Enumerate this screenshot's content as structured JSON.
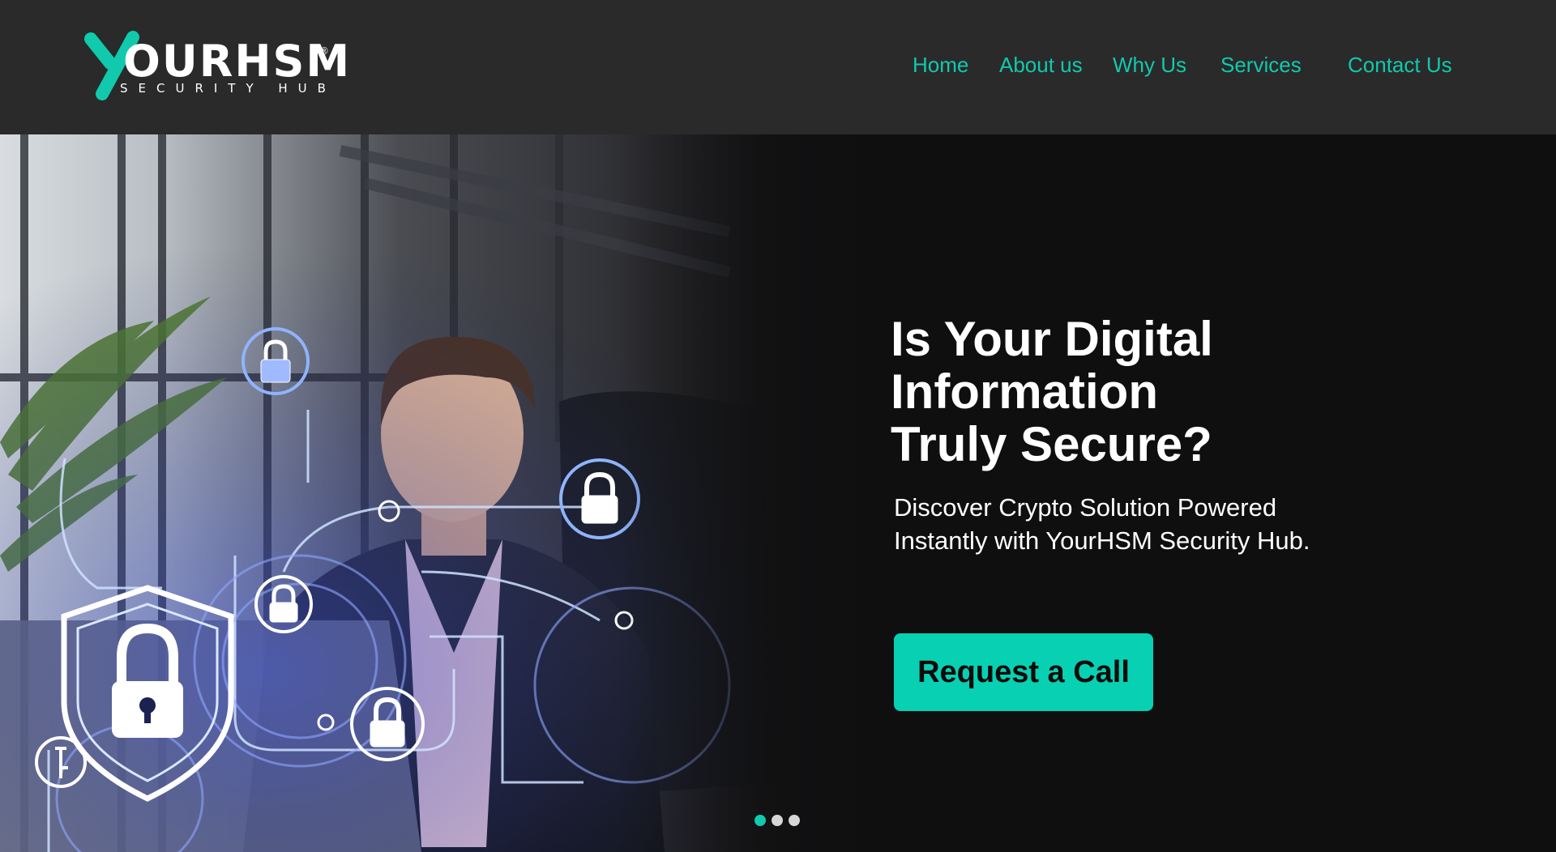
{
  "brand": {
    "logo_word": "OURHSM",
    "logo_registered": "®",
    "logo_tagline": "SECURITY HUB",
    "accent_color": "#11c9ad",
    "button_color": "#08d0b2",
    "header_bg": "#2a2a2a",
    "hero_bg": "#0f0f10"
  },
  "nav": {
    "items": [
      {
        "label": "Home"
      },
      {
        "label": "About us"
      },
      {
        "label": "Why Us"
      },
      {
        "label": "Services"
      },
      {
        "label": "Contact Us"
      }
    ]
  },
  "hero": {
    "title_lines": [
      "Is Your Digital",
      "Information",
      "Truly Secure?"
    ],
    "subtitle_lines": [
      "Discover Crypto Solution Powered",
      "Instantly with YourHSM Security Hub."
    ],
    "cta_label": "Request a Call",
    "image_icon": "cybersecurity-businessman-photo"
  },
  "carousel": {
    "slide_count": 3,
    "active_index": 0
  }
}
